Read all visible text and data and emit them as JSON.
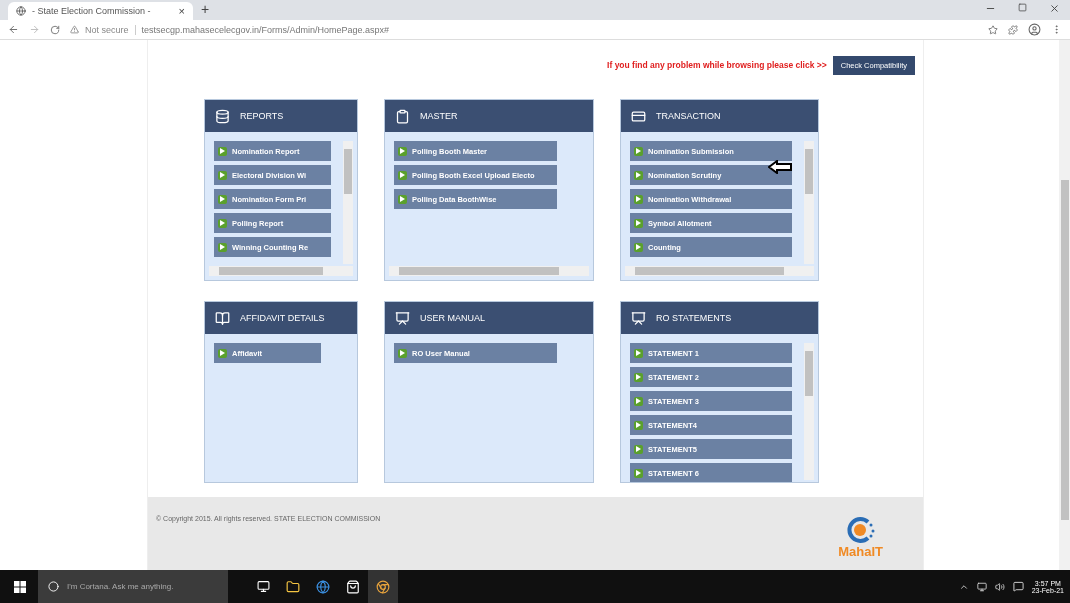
{
  "browser": {
    "tab_title": "- State Election Commission -",
    "tab_close": "×",
    "new_tab": "+",
    "security": "Not secure",
    "url": "testsecgp.mahasecelecgov.in/Forms/Admin/HomePage.aspx#"
  },
  "notice": {
    "message": "If you find any problem while browsing please click >>",
    "button": "Check Compatibility"
  },
  "panels": [
    {
      "title": "REPORTS",
      "items": [
        "Nomination Report",
        "Electoral Division Wi",
        "Nomination Form Pri",
        "Polling Report",
        "Winning Counting Re"
      ]
    },
    {
      "title": "MASTER",
      "items": [
        "Polling Booth Master",
        "Polling Booth Excel Upload Electo",
        "Polling Data BoothWise"
      ]
    },
    {
      "title": "TRANSACTION",
      "items": [
        "Nomination Submission",
        "Nomination Scrutiny",
        "Nomination Withdrawal",
        "Symbol Allotment",
        "Counting"
      ]
    },
    {
      "title": "AFFIDAVIT DETAILS",
      "items": [
        "Affidavit"
      ]
    },
    {
      "title": "USER MANUAL",
      "items": [
        "RO User Manual"
      ]
    },
    {
      "title": "RO STATEMENTS",
      "items": [
        "STATEMENT 1",
        "STATEMENT 2",
        "STATEMENT 3",
        "STATEMENT4",
        "STATEMENT5",
        "STATEMENT 6"
      ]
    }
  ],
  "footer": {
    "copyright": "© Copyright 2015. All rights reserved. STATE ELECTION COMMISSION",
    "logo": "MahaIT"
  },
  "taskbar": {
    "search_placeholder": "I'm Cortana. Ask me anything.",
    "time": "3:57 PM",
    "date": "23-Feb-21"
  }
}
